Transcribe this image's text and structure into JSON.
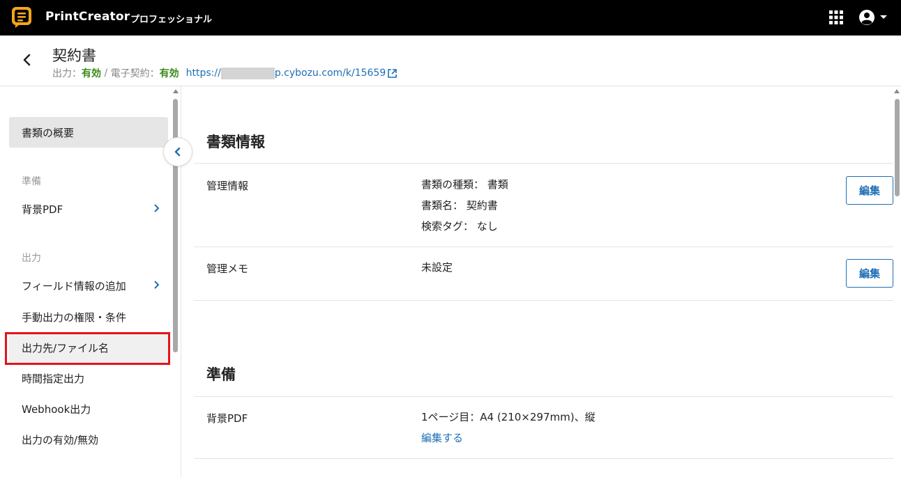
{
  "app": {
    "name": "PrintCreator",
    "edition": "プロフェッショナル",
    "icons": {
      "apps": "apps-grid-icon",
      "user": "user-account-icon",
      "menu": "chevron-down-icon"
    }
  },
  "header": {
    "title": "契約書",
    "output_label": "出力：",
    "output_status": "有効",
    "separator": " / ",
    "esign_label": "電子契約：",
    "esign_status": "有効",
    "url_prefix": "https://",
    "url_suffix": "p.cybozu.com/k/15659",
    "status_color": "#3a8a1a",
    "link_color": "#1e6fb5"
  },
  "sidebar": {
    "overview": "書類の概要",
    "section_prepare": "準備",
    "bg_pdf": "背景PDF",
    "section_output": "出力",
    "field_info": "フィールド情報の追加",
    "manual_output": "手動出力の権限・条件",
    "destination": "出力先/ファイル名",
    "scheduled": "時間指定出力",
    "webhook": "Webhook出力",
    "enable": "出力の有効/無効"
  },
  "main": {
    "doc_info_title": "書類情報",
    "mgmt_label": "管理情報",
    "mgmt_values": [
      "書類の種類： 書類",
      "書類名： 契約書",
      "検索タグ： なし"
    ],
    "memo_label": "管理メモ",
    "memo_value": "未設定",
    "edit_label": "編集",
    "prepare_title": "準備",
    "bg_label": "背景PDF",
    "bg_value": "1ページ目：A4 (210×297mm)、縦",
    "bg_edit_link": "編集する"
  }
}
